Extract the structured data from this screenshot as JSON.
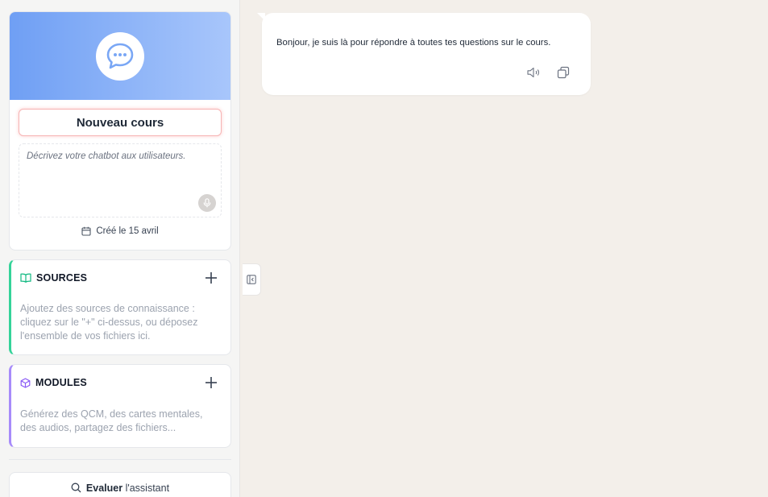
{
  "project": {
    "title": "Nouveau cours",
    "description_placeholder": "Décrivez votre chatbot aux utilisateurs.",
    "created_label": "Créé le 15 avril"
  },
  "sources": {
    "heading": "SOURCES",
    "hint": "Ajoutez des sources de connaissance : cliquez sur le \"+\" ci-dessus, ou déposez l'ensemble de vos fichiers ici."
  },
  "modules": {
    "heading": "MODULES",
    "hint": "Générez des QCM, des cartes mentales, des audios, partagez des fichiers..."
  },
  "evaluate": {
    "bold": "Evaluer",
    "rest": " l'assistant"
  },
  "chat": {
    "messages": [
      {
        "role": "assistant",
        "text": "Bonjour, je suis là pour répondre à toutes tes questions sur le cours."
      }
    ]
  },
  "icons": {
    "hero": "chat-bubble-icon",
    "mic": "microphone-icon",
    "calendar": "calendar-icon",
    "sources": "book-open-icon",
    "modules": "cube-icon",
    "add": "plus-icon",
    "search": "search-icon",
    "collapse": "sidebar-collapse-icon",
    "speaker": "speaker-icon",
    "copy": "copy-icon"
  },
  "colors": {
    "sources_accent": "#34d399",
    "modules_accent": "#a78bfa",
    "hero_start": "#6f9ff4",
    "hero_end": "#a8c6fb",
    "title_border": "#f7b4b4",
    "background": "#f3efea"
  }
}
